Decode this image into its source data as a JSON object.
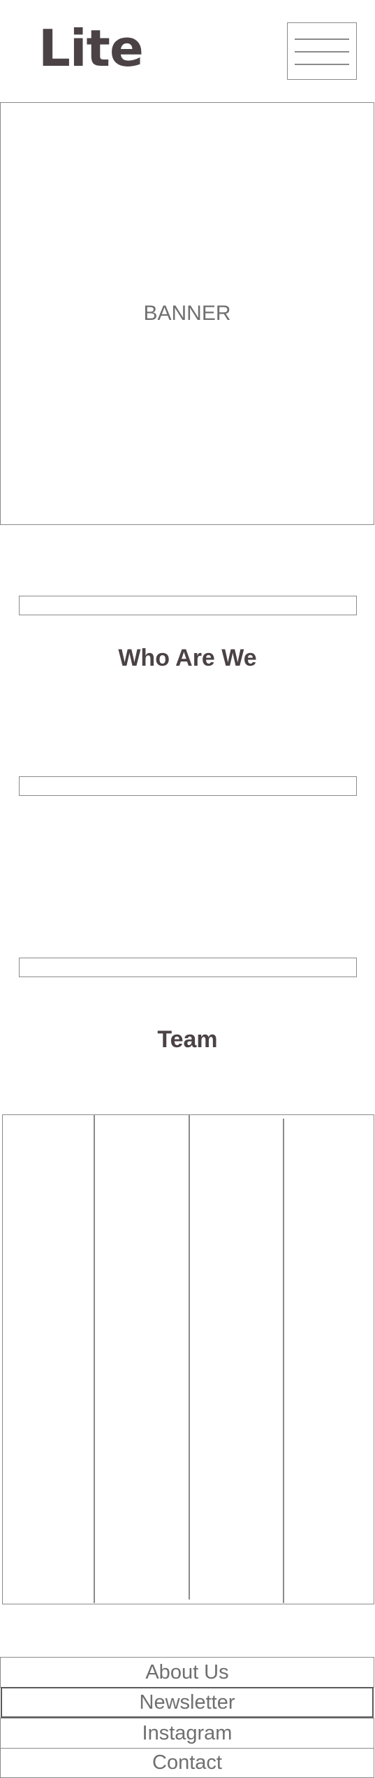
{
  "header": {
    "logo_text": "Lite",
    "menu_icon": "hamburger-menu-icon"
  },
  "banner": {
    "label": "BANNER"
  },
  "sections": {
    "who_are_we": {
      "title": "Who Are We"
    },
    "team": {
      "title": "Team"
    }
  },
  "team": {
    "columns": 4
  },
  "footer": {
    "items": [
      {
        "label": "About Us"
      },
      {
        "label": "Newsletter"
      },
      {
        "label": "Instagram"
      },
      {
        "label": "Contact"
      }
    ]
  },
  "colors": {
    "heading": "#4b4245",
    "muted_text": "#6f6f6f",
    "border": "#8a8a8a"
  }
}
